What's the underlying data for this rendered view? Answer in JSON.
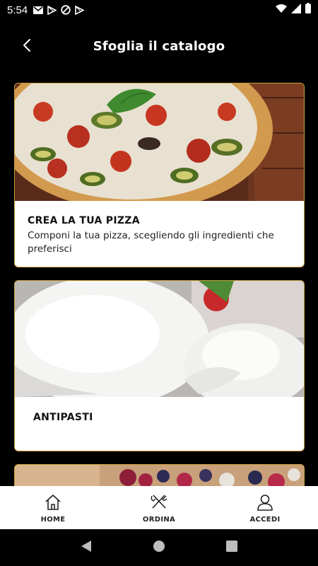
{
  "status_bar": {
    "time": "5:54",
    "left_icons": [
      "gmail-icon",
      "play-store-icon",
      "at-sign-icon",
      "play-store-icon"
    ],
    "right_icons": [
      "wifi-icon",
      "signal-icon",
      "battery-icon"
    ]
  },
  "header": {
    "title": "Sfoglia il catalogo",
    "back_icon": "chevron-left-icon"
  },
  "catalog": {
    "cards": [
      {
        "title": "CREA LA TUA PIZZA",
        "description": "Componi la tua pizza, scegliendo gli ingredienti che preferisci",
        "image": "pizza-photo"
      },
      {
        "title": "ANTIPASTI",
        "description": "",
        "image": "mozzarella-photo"
      },
      {
        "title": "",
        "description": "",
        "image": "dessert-photo"
      }
    ]
  },
  "bottom_nav": {
    "items": [
      {
        "label": "HOME",
        "icon": "home-icon"
      },
      {
        "label": "ORDINA",
        "icon": "utensils-icon"
      },
      {
        "label": "ACCEDI",
        "icon": "user-icon"
      }
    ]
  },
  "system_nav": [
    "back-triangle-icon",
    "home-circle-icon",
    "recents-square-icon"
  ],
  "colors": {
    "background": "#000000",
    "card_border": "#c9a13b",
    "card_bg": "#ffffff",
    "text_dark": "#111111"
  }
}
